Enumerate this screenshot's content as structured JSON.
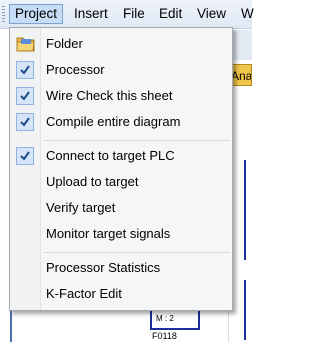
{
  "menubar": {
    "items": [
      {
        "label": "Project",
        "active": true
      },
      {
        "label": "Insert"
      },
      {
        "label": "File"
      },
      {
        "label": "Edit"
      },
      {
        "label": "View"
      },
      {
        "label": "W"
      }
    ]
  },
  "background": {
    "tab_label": "Ana",
    "block_text": "M : 2",
    "block_id": "F0118"
  },
  "dropdown": {
    "items": [
      {
        "label": "Folder",
        "icon": "folder-icon"
      },
      {
        "label": "Processor",
        "checked": true
      },
      {
        "label": "Wire Check this sheet",
        "checked": true
      },
      {
        "label": "Compile entire diagram",
        "checked": true
      },
      {
        "label": "Connect to target PLC",
        "checked": true
      },
      {
        "label": "Upload to target"
      },
      {
        "label": "Verify target"
      },
      {
        "label": "Monitor target signals"
      },
      {
        "label": "Processor Statistics"
      },
      {
        "label": "K-Factor Edit"
      }
    ]
  },
  "colors": {
    "highlight": "#c7dcf5",
    "check_bg": "#d5e4f6",
    "check_mark": "#1d4d8a",
    "tab_accent": "#f0c64a"
  }
}
